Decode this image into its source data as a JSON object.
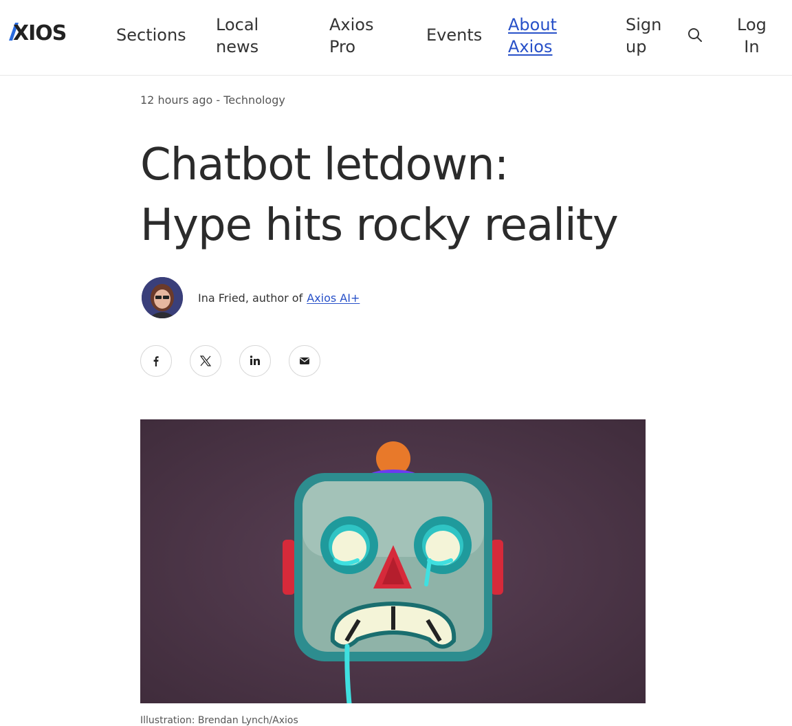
{
  "header": {
    "logo_text": "AXIOS",
    "nav": {
      "sections": "Sections",
      "local_news_line1": "Local",
      "local_news_line2": "news",
      "axios_pro_line1": "Axios",
      "axios_pro_line2": "Pro",
      "events": "Events",
      "about_line1": "About",
      "about_line2": "Axios",
      "signup_line1": "Sign",
      "signup_line2": "up",
      "login_line1": "Log",
      "login_line2": "In"
    },
    "search_icon": "search-icon"
  },
  "article": {
    "meta": "12 hours ago - Technology",
    "headline_line1": "Chatbot letdown:",
    "headline_line2": "Hype hits rocky reality",
    "byline": {
      "author_text": "Ina Fried, author of",
      "newsletter_link": "Axios AI+"
    },
    "share": {
      "icons": [
        "facebook-icon",
        "x-icon",
        "linkedin-icon",
        "email-icon"
      ]
    },
    "caption": "Illustration: Brendan Lynch/Axios"
  },
  "colors": {
    "link": "#2750c8",
    "logo_accent": "#2a6bdf",
    "hero_bg": "#4a3545",
    "robot_face": "#8fb3a8",
    "robot_eye_ring": "#1f9a9c",
    "robot_nose": "#d62a3a",
    "robot_tear": "#3fe0e0",
    "robot_antenna": "#e8792a",
    "robot_antenna_base": "#6b3cf0"
  }
}
